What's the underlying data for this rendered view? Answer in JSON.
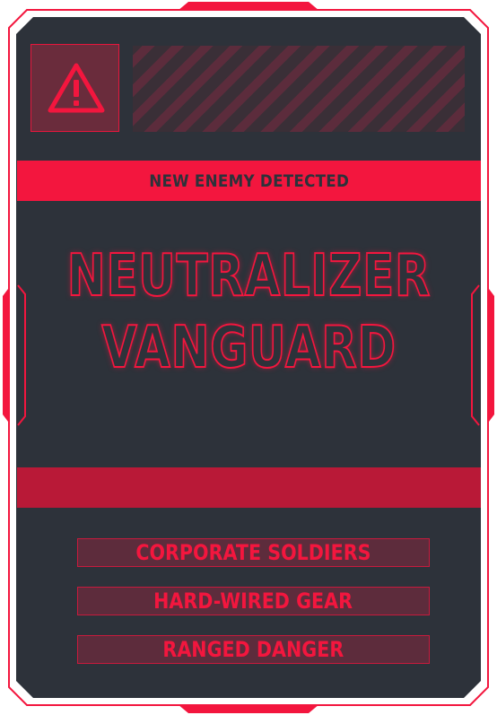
{
  "card": {
    "alert_label": "NEW ENEMY DETECTED",
    "enemy_name_line1": "NEUTRALIZER",
    "enemy_name_line2": "VANGUARD",
    "traits": [
      {
        "label": "CORPORATE SOLDIERS"
      },
      {
        "label": "HARD-WIRED GEAR"
      },
      {
        "label": "RANGED DANGER"
      }
    ],
    "icons": {
      "warning": "warning-triangle-icon"
    }
  },
  "colors": {
    "accent": "#f3163e",
    "dark_red": "#b91937",
    "panel": "#2d323a",
    "trait_fill": "#5d2c3c",
    "stripe": "#5c2c3c"
  }
}
